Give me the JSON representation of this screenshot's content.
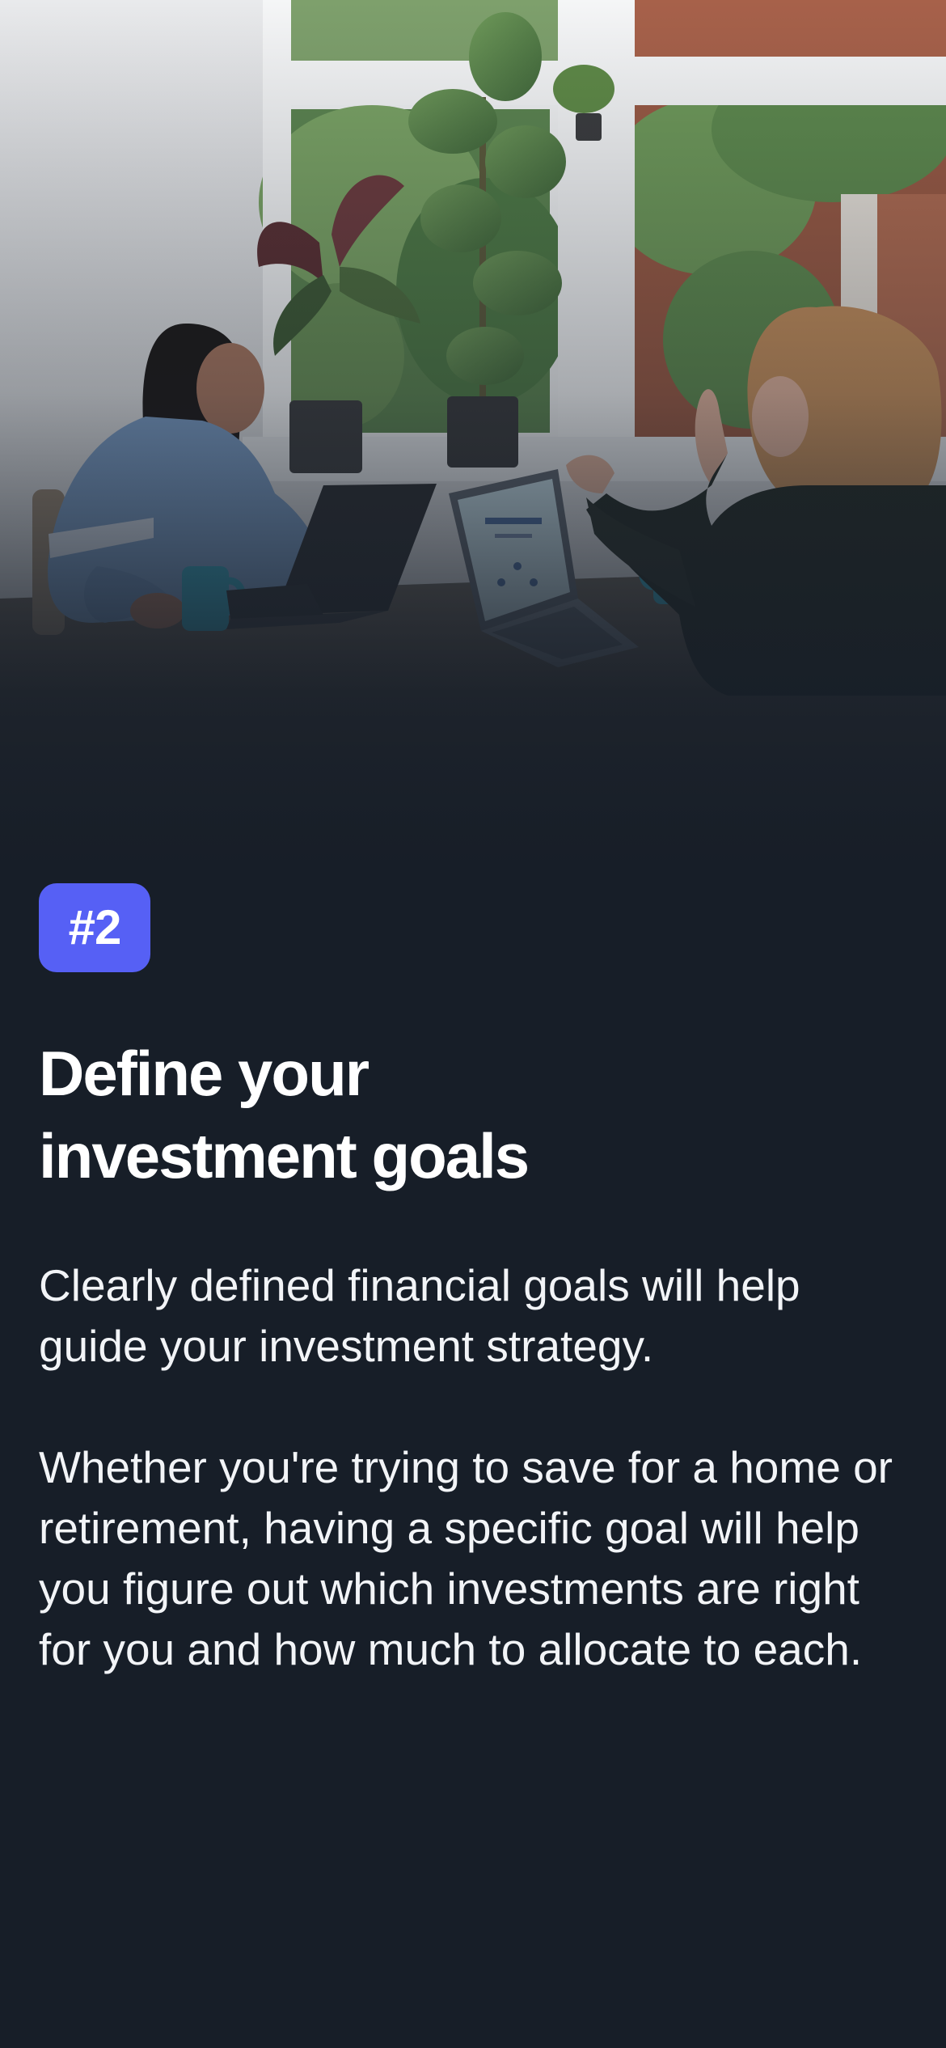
{
  "colors": {
    "background": "#171e28",
    "badge_background": "#5660f5",
    "title_text": "#ffffff",
    "body_text": "#f2f4f7"
  },
  "hero": {
    "image_kind": "photo-two-people-meeting-with-laptops"
  },
  "onboarding": {
    "step_badge": "#2",
    "title": "Define your investment goals",
    "paragraphs": [
      "Clearly defined financial goals will help guide your investment strategy.",
      "Whether you're trying to save for a home or retirement, having a specific goal will help you figure out which investments are right for you and how much to allocate to each."
    ]
  }
}
